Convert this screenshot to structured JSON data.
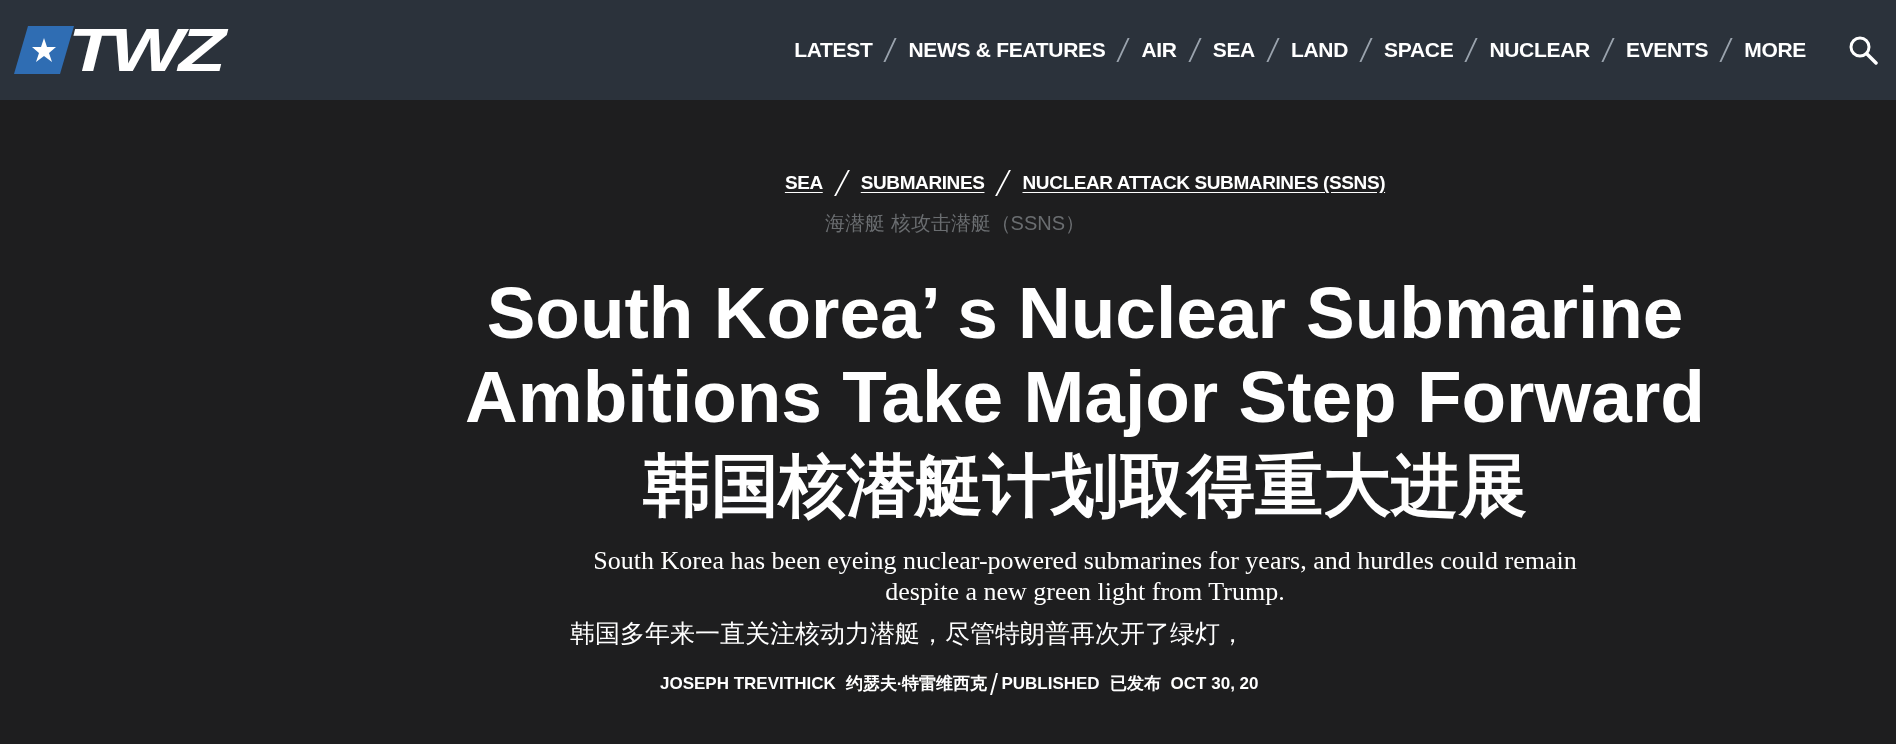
{
  "header": {
    "logo_text": "TWZ",
    "nav": [
      {
        "label": "LATEST"
      },
      {
        "label": "NEWS & FEATURES"
      },
      {
        "label": "AIR"
      },
      {
        "label": "SEA"
      },
      {
        "label": "LAND"
      },
      {
        "label": "SPACE"
      },
      {
        "label": "NUCLEAR"
      },
      {
        "label": "EVENTS"
      },
      {
        "label": "MORE"
      }
    ]
  },
  "article": {
    "breadcrumbs": [
      "SEA",
      "SUBMARINES",
      "NUCLEAR ATTACK SUBMARINES (SSNS)"
    ],
    "breadcrumbs_translation": "海潜艇 核攻击潜艇（SSNS）",
    "title_lines": [
      "South Korea’ s Nuclear Submarine",
      "Ambitions Take Major Step Forward"
    ],
    "title_translation": "韩国核潜艇计划取得重大进展",
    "deck": "South Korea has been eyeing nuclear-powered submarines for years, and hurdles could remain despite a new green light from Trump.",
    "deck_translation": "韩国多年来一直关注核动力潜艇，尽管特朗普再次开了绿灯，",
    "byline": {
      "author": "JOSEPH TREVITHICK",
      "author_translation": "约瑟夫·特雷维西克",
      "published_label": "PUBLISHED",
      "published_translation": "已发布",
      "date": "OCT 30, 20"
    }
  }
}
